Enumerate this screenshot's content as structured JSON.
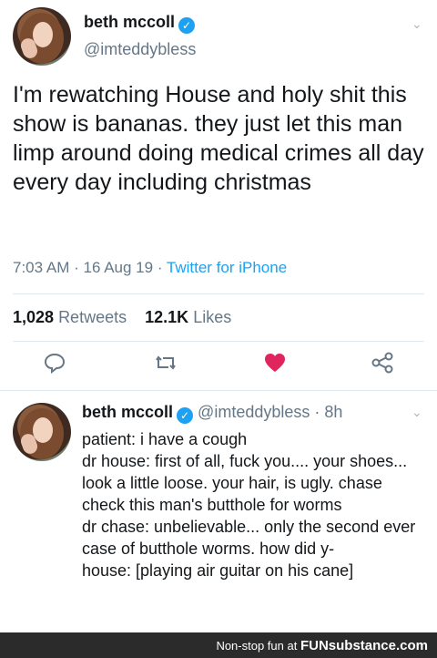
{
  "main_tweet": {
    "name": "beth mccoll",
    "handle": "@imteddybless",
    "text": "I'm rewatching House and holy shit this show is bananas. they just let this man limp around doing medical crimes all day every day including christmas",
    "time": "7:03 AM",
    "date": "16 Aug 19",
    "source": "Twitter for iPhone",
    "retweets_count": "1,028",
    "retweets_label": "Retweets",
    "likes_count": "12.1K",
    "likes_label": "Likes"
  },
  "reply": {
    "name": "beth mccoll",
    "handle": "@imteddybless",
    "age": "8h",
    "lines": [
      "patient: i have a cough",
      "dr house: first of all, fuck you.... your shoes... look a little loose. your hair, is ugly. chase check this man's butthole for worms",
      "dr chase: unbelievable... only the second ever case of butthole worms. how did y-",
      "house: [playing air guitar on his cane]"
    ]
  },
  "footer": {
    "prefix": "Non-stop fun at",
    "brand": "FUNsubstance.com"
  },
  "icons": {
    "reply": "reply-icon",
    "retweet": "retweet-icon",
    "like": "heart-icon",
    "share": "share-icon",
    "verified": "verified-icon",
    "chevron": "chevron-down-icon"
  },
  "colors": {
    "accent": "#1da1f2",
    "like": "#e0245e",
    "muted": "#657786"
  }
}
